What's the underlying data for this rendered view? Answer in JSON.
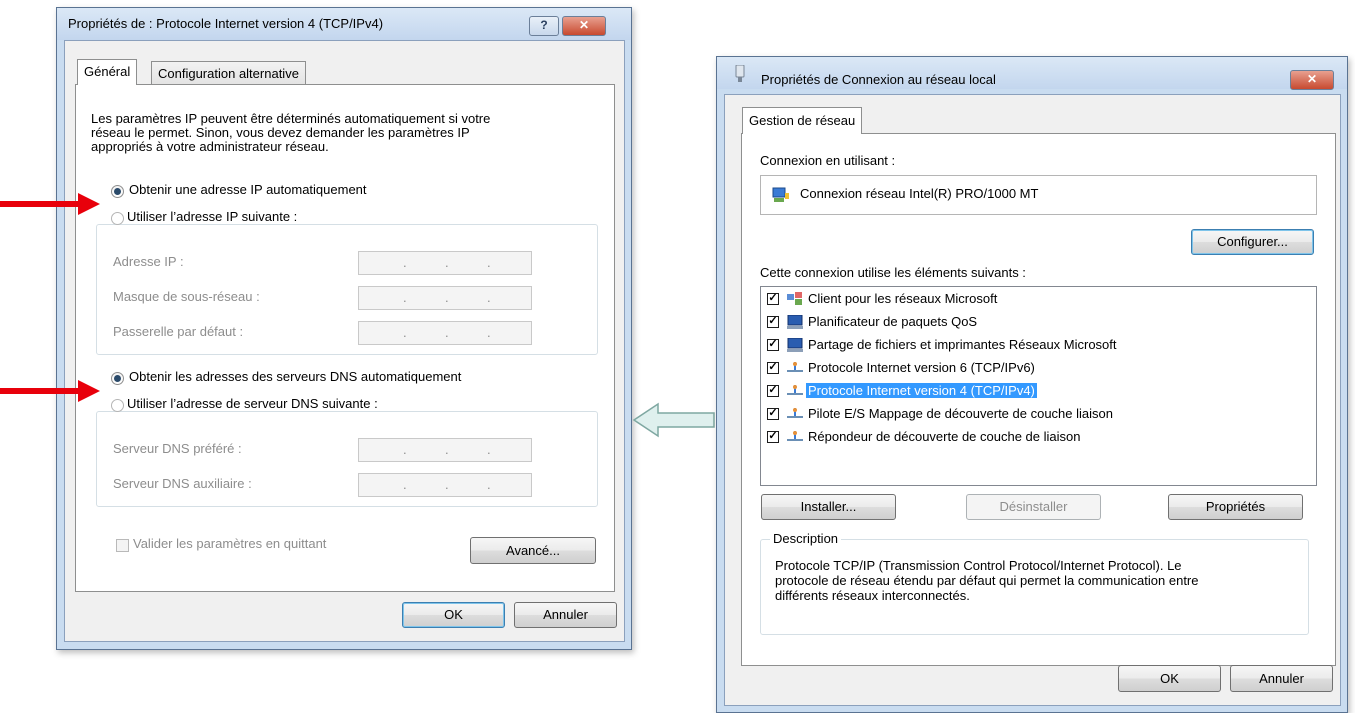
{
  "ipv4_window": {
    "title": "Propriétés de : Protocole Internet version 4 (TCP/IPv4)",
    "help_label": "?",
    "close_label": "✕",
    "tabs": [
      {
        "label": "Général",
        "active": true
      },
      {
        "label": "Configuration alternative",
        "active": false
      }
    ],
    "description": [
      "Les paramètres IP peuvent être déterminés automatiquement si votre",
      "réseau le permet. Sinon, vous devez demander les paramètres IP",
      "appropriés à votre administrateur réseau."
    ],
    "ip_auto_label": "Obtenir une adresse IP automatiquement",
    "ip_manual_label": "Utiliser l’adresse IP suivante :",
    "ip_fields": [
      {
        "label": "Adresse IP :"
      },
      {
        "label": "Masque de sous-réseau :"
      },
      {
        "label": "Passerelle par défaut :"
      }
    ],
    "dns_auto_label": "Obtenir les adresses des serveurs DNS automatiquement",
    "dns_manual_label": "Utiliser l’adresse de serveur DNS suivante :",
    "dns_fields": [
      {
        "label": "Serveur DNS préféré :"
      },
      {
        "label": "Serveur DNS auxiliaire :"
      }
    ],
    "ip_placeholder_dots": ".",
    "validate_label": "Valider les paramètres en quittant",
    "advanced_label": "Avancé...",
    "ok_label": "OK",
    "cancel_label": "Annuler"
  },
  "lan_window": {
    "title": "Propriétés de Connexion au réseau local",
    "close_label": "✕",
    "tab_label": "Gestion de réseau",
    "connect_using_label": "Connexion en utilisant :",
    "adapter_name": "Connexion réseau Intel(R) PRO/1000 MT",
    "configure_label": "Configurer...",
    "components_label": "Cette connexion utilise les éléments suivants :",
    "components": [
      {
        "label": "Client pour les réseaux Microsoft",
        "checked": true,
        "icon": "network-client-icon"
      },
      {
        "label": "Planificateur de paquets QoS",
        "checked": true,
        "icon": "computer-icon"
      },
      {
        "label": "Partage de fichiers et imprimantes Réseaux Microsoft",
        "checked": true,
        "icon": "computer-icon"
      },
      {
        "label": "Protocole Internet version 6 (TCP/IPv6)",
        "checked": true,
        "icon": "protocol-icon"
      },
      {
        "label": "Protocole Internet version 4 (TCP/IPv4)",
        "checked": true,
        "icon": "protocol-icon",
        "selected": true
      },
      {
        "label": "Pilote E/S Mappage de découverte de couche liaison",
        "checked": true,
        "icon": "protocol-icon"
      },
      {
        "label": "Répondeur de découverte de couche de liaison",
        "checked": true,
        "icon": "protocol-icon"
      }
    ],
    "install_label": "Installer...",
    "uninstall_label": "Désinstaller",
    "properties_label": "Propriétés",
    "description_title": "Description",
    "description_lines": [
      "Protocole TCP/IP (Transmission Control Protocol/Internet Protocol). Le",
      "protocole de réseau étendu par défaut qui permet la communication entre",
      "différents réseaux interconnectés."
    ],
    "ok_label": "OK",
    "cancel_label": "Annuler"
  },
  "colors": {
    "arrow_red": "#e8000b",
    "arrow_link_fill": "#dff0ee",
    "arrow_link_stroke": "#7fa8a2",
    "selection": "#3399ff"
  }
}
